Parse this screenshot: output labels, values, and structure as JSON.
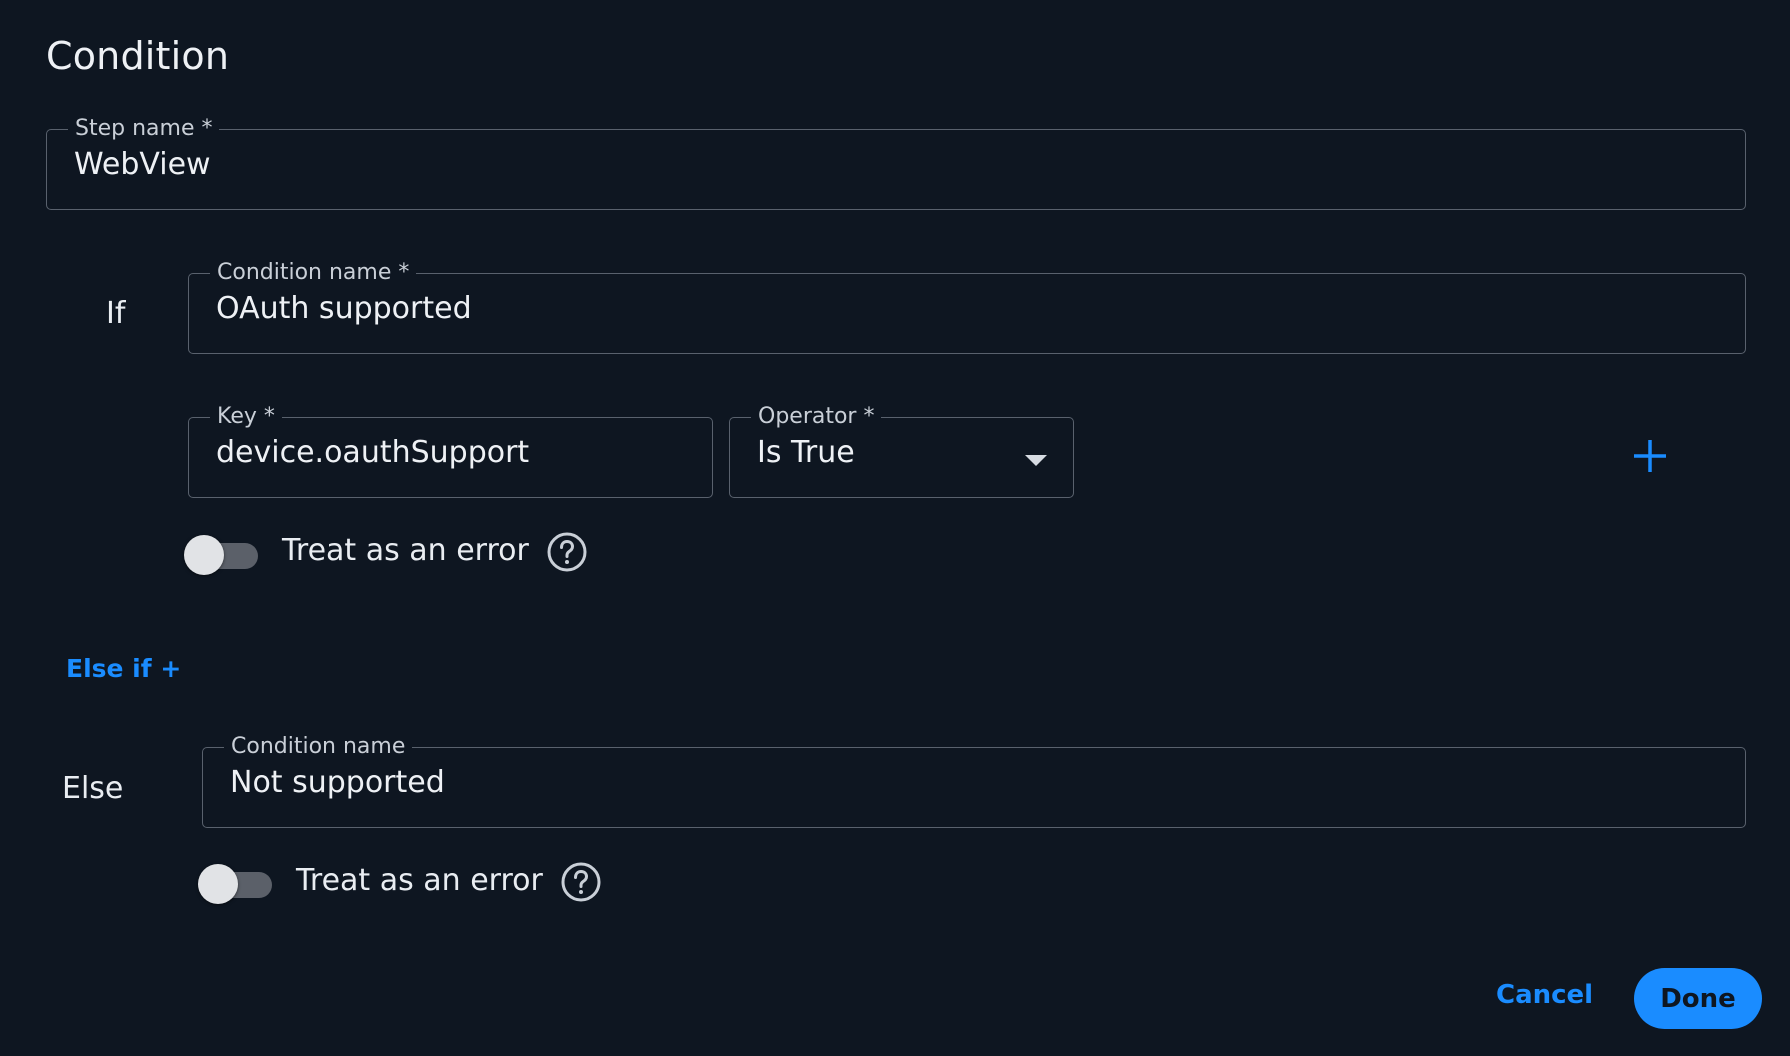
{
  "dialog": {
    "title": "Condition"
  },
  "step_name": {
    "label": "Step name *",
    "value": "WebView"
  },
  "if_block": {
    "label": "If",
    "condition_name": {
      "label": "Condition name *",
      "value": "OAuth supported"
    },
    "key": {
      "label": "Key *",
      "value": "device.oauthSupport"
    },
    "operator": {
      "label": "Operator *",
      "value": "Is True"
    },
    "treat_as_error": {
      "label": "Treat as an error",
      "checked": false
    }
  },
  "else_if_link": "Else if +",
  "else_block": {
    "label": "Else",
    "condition_name": {
      "label": "Condition name",
      "value": "Not supported"
    },
    "treat_as_error": {
      "label": "Treat as an error",
      "checked": false
    }
  },
  "actions": {
    "cancel_label": "Cancel",
    "done_label": "Done"
  },
  "colors": {
    "background": "#0e1621",
    "accent": "#1a8cff",
    "border": "#59616d"
  },
  "icons": {
    "add": "plus-icon",
    "help": "question-circle-icon",
    "dropdown": "caret-down-icon"
  }
}
